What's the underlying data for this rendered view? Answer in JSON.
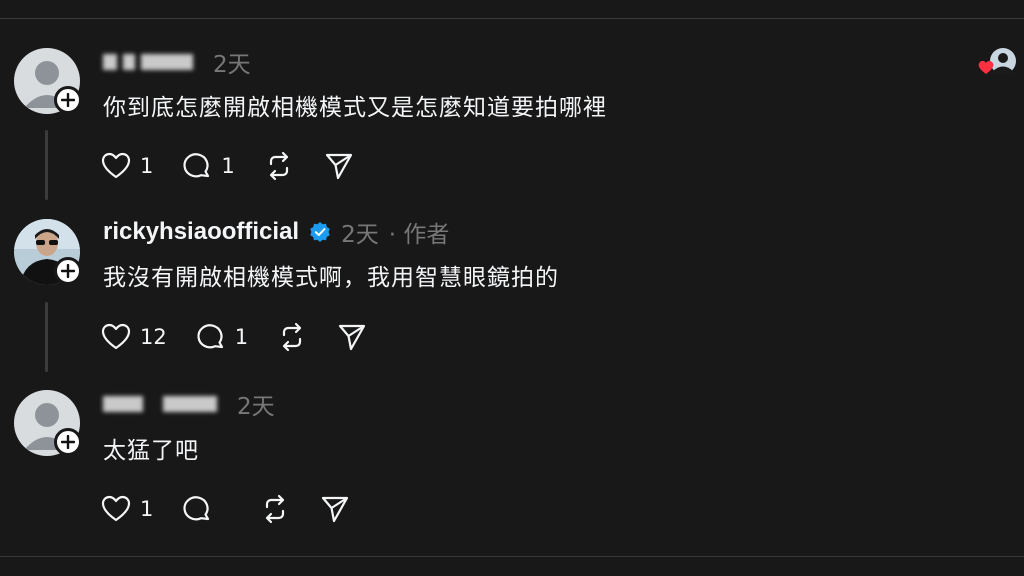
{
  "comments": [
    {
      "username": "",
      "time": "2天",
      "author_tag": "",
      "text": "你到底怎麼開啟相機模式又是怎麼知道要拍哪裡",
      "likes": "1",
      "replies": "1"
    },
    {
      "username": "rickyhsiaoofficial",
      "time": "2天",
      "author_tag": "· 作者",
      "text": "我沒有開啟相機模式啊，我用智慧眼鏡拍的",
      "likes": "12",
      "replies": "1"
    },
    {
      "username": "",
      "time": "2天",
      "author_tag": "",
      "text": "太猛了吧",
      "likes": "1",
      "replies": ""
    }
  ],
  "icons": {
    "like": "heart-icon",
    "reply": "comment-icon",
    "repost": "repost-icon",
    "share": "send-icon",
    "verified": "verified-badge-icon",
    "follow": "plus-icon"
  },
  "colors": {
    "background": "#181818",
    "text": "#f3f5f7",
    "muted": "#777777",
    "verified": "#1d9bf0",
    "heart": "#ff3040"
  }
}
